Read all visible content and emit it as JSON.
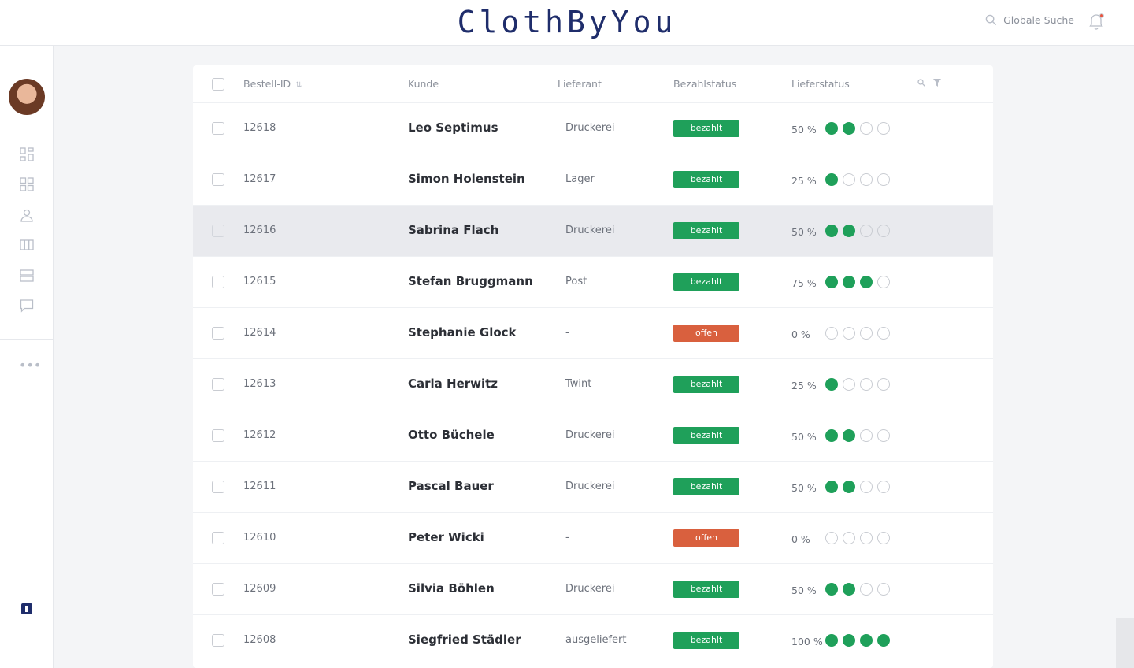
{
  "app": {
    "brand": "ClothByYou"
  },
  "header": {
    "search_placeholder": "Globale Suche",
    "search_icon": "search-icon",
    "bell_icon": "bell-icon",
    "notification_color": "#e8533d"
  },
  "sidebar": {
    "icons": [
      "dashboard-icon",
      "apps-icon",
      "user-icon",
      "columns-icon",
      "rows-icon",
      "chat-icon"
    ],
    "more_label": "•••",
    "brand_color": "#1f2d6b"
  },
  "table": {
    "columns": {
      "id": "Bestell-ID",
      "customer": "Kunde",
      "supplier": "Lieferant",
      "payment": "Bezahlstatus",
      "delivery": "Lieferstatus"
    },
    "colors": {
      "paid": "#1fa05a",
      "open": "#d9603e",
      "dot_on": "#1fa05a"
    },
    "rows": [
      {
        "id": "12618",
        "customer": "Leo Septimus",
        "supplier": "Druckerei",
        "payment": "bezahlt",
        "payment_type": "paid",
        "percent": "50 %",
        "progress": 2
      },
      {
        "id": "12617",
        "customer": "Simon Holenstein",
        "supplier": "Lager",
        "payment": "bezahlt",
        "payment_type": "paid",
        "percent": "25 %",
        "progress": 1
      },
      {
        "id": "12616",
        "customer": "Sabrina Flach",
        "supplier": "Druckerei",
        "payment": "bezahlt",
        "payment_type": "paid",
        "percent": "50 %",
        "progress": 2,
        "highlighted": true
      },
      {
        "id": "12615",
        "customer": "Stefan Bruggmann",
        "supplier": "Post",
        "payment": "bezahlt",
        "payment_type": "paid",
        "percent": "75 %",
        "progress": 3
      },
      {
        "id": "12614",
        "customer": "Stephanie Glock",
        "supplier": "-",
        "payment": "offen",
        "payment_type": "open",
        "percent": "0 %",
        "progress": 0
      },
      {
        "id": "12613",
        "customer": "Carla Herwitz",
        "supplier": "Twint",
        "payment": "bezahlt",
        "payment_type": "paid",
        "percent": "25 %",
        "progress": 1
      },
      {
        "id": "12612",
        "customer": "Otto Büchele",
        "supplier": "Druckerei",
        "payment": "bezahlt",
        "payment_type": "paid",
        "percent": "50 %",
        "progress": 2
      },
      {
        "id": "12611",
        "customer": "Pascal Bauer",
        "supplier": "Druckerei",
        "payment": "bezahlt",
        "payment_type": "paid",
        "percent": "50 %",
        "progress": 2
      },
      {
        "id": "12610",
        "customer": "Peter Wicki",
        "supplier": "-",
        "payment": "offen",
        "payment_type": "open",
        "percent": "0 %",
        "progress": 0
      },
      {
        "id": "12609",
        "customer": "Silvia Böhlen",
        "supplier": "Druckerei",
        "payment": "bezahlt",
        "payment_type": "paid",
        "percent": "50 %",
        "progress": 2
      },
      {
        "id": "12608",
        "customer": "Siegfried Städler",
        "supplier": "ausgeliefert",
        "payment": "bezahlt",
        "payment_type": "paid",
        "percent": "100 %",
        "progress": 4
      }
    ]
  }
}
